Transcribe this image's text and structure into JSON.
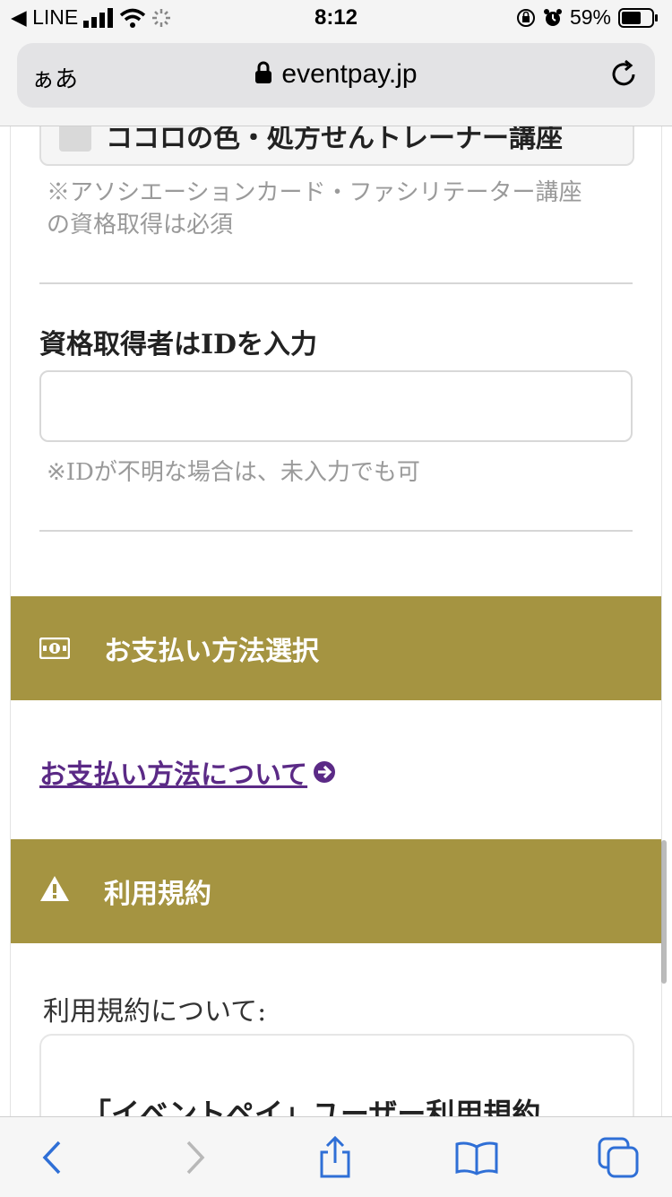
{
  "status_bar": {
    "back_app": "◀ LINE",
    "time": "8:12",
    "battery": "59%"
  },
  "browser": {
    "aa_label": "ぁあ",
    "url": "eventpay.jp"
  },
  "form": {
    "checkbox_option_label": "ココロの色・処方せんトレーナー講座",
    "certification_note": "※アソシエーションカード・ファシリテーター講座\nの資格取得は必須",
    "id_label": "資格取得者はIDを入力",
    "id_value": "",
    "id_note": "※IDが不明な場合は、未入力でも可"
  },
  "payment_section": {
    "title": "お支払い方法選択",
    "icon": "money-bill-icon",
    "link_label": "お支払い方法について"
  },
  "terms_section": {
    "title": "利用規約",
    "icon": "warning-icon",
    "about_label": "利用規約について:",
    "box_title": "「イベントペイ」ユーザー利用規約"
  },
  "colors": {
    "section_header": "#a59441",
    "link": "#5b2a86"
  }
}
